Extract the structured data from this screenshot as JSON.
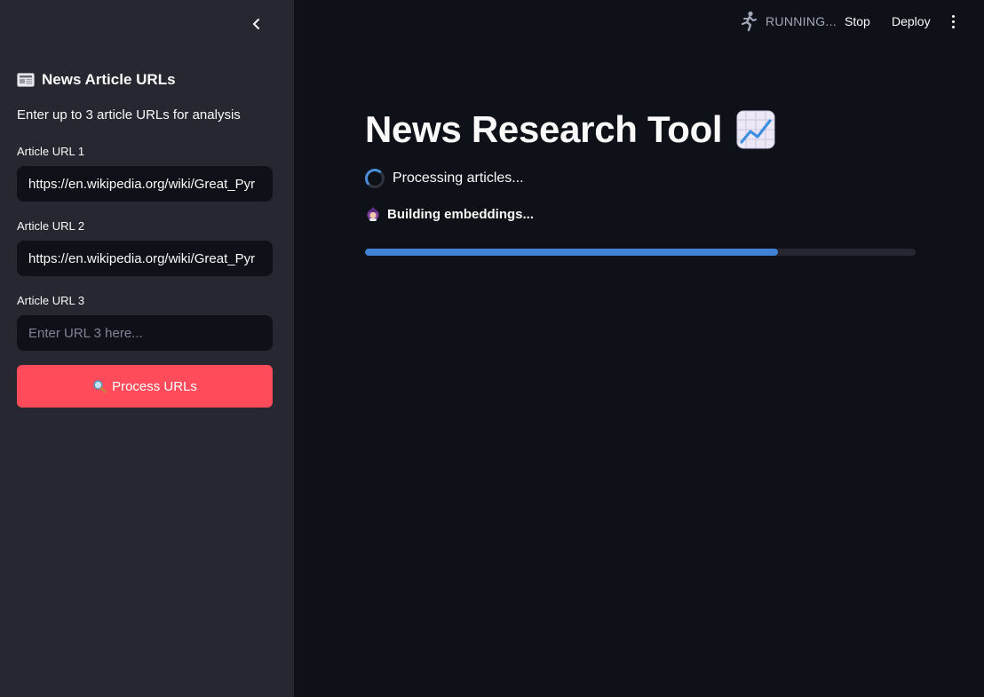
{
  "sidebar": {
    "header_icon": "newspaper-icon",
    "header": "News Article URLs",
    "description": "Enter up to 3 article URLs for analysis",
    "fields": [
      {
        "label": "Article URL 1",
        "value": "https://en.wikipedia.org/wiki/Great_Pyr",
        "placeholder": ""
      },
      {
        "label": "Article URL 2",
        "value": "https://en.wikipedia.org/wiki/Great_Pyr",
        "placeholder": ""
      },
      {
        "label": "Article URL 3",
        "value": "",
        "placeholder": "Enter URL 3 here..."
      }
    ],
    "button_icon": "magnifier-icon",
    "button_label": "Process URLs",
    "button_color": "#ff4b5a"
  },
  "toolbar": {
    "status_icon": "running-man-icon",
    "status": "RUNNING...",
    "stop": "Stop",
    "deploy": "Deploy",
    "menu_icon": "more-vertical-icon"
  },
  "main": {
    "title": "News Research Tool",
    "title_icon": "chart-increasing-icon",
    "spinner_text": "Processing articles...",
    "status_icon": "wizard-icon",
    "status_text": "Building embeddings...",
    "progress": 0.75,
    "progress_color": "#3f82d6"
  }
}
